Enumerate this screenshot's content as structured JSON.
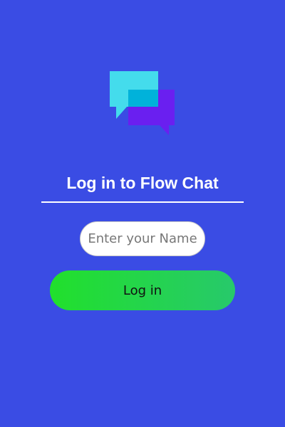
{
  "login": {
    "title": "Log in to Flow Chat",
    "name_placeholder": "Enter your Name",
    "name_value": "",
    "button_label": "Log in"
  },
  "icons": {
    "logo": "chat-bubbles-icon"
  },
  "colors": {
    "background": "#3a4ce4",
    "bubble_front": "#44dcec",
    "bubble_back": "#6a1ff0",
    "bubble_overlap": "#00b2da",
    "button_gradient_start": "#21e02c",
    "button_gradient_end": "#27c96b",
    "title_text": "#ffffff"
  }
}
